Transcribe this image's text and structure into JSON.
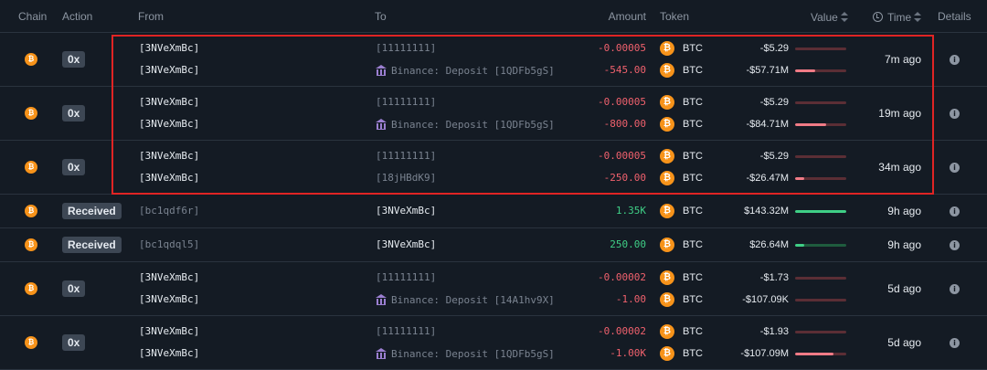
{
  "header": {
    "chain": "Chain",
    "action": "Action",
    "from": "From",
    "to": "To",
    "amount": "Amount",
    "token": "Token",
    "value": "Value",
    "time": "Time",
    "details": "Details"
  },
  "colors": {
    "highlight_border": "#e02424",
    "negative": "#f0616d",
    "positive": "#3fcf86",
    "btc": "#f7931a"
  },
  "rows": [
    {
      "action": "0x",
      "time": "7m ago",
      "lines": [
        {
          "from": "[3NVeXmBc]",
          "to": "[11111111]",
          "amount": "-0.00005",
          "token": "BTC",
          "value": "-$5.29",
          "bar": 0.0
        },
        {
          "from": "[3NVeXmBc]",
          "to": "Binance: Deposit [1QDFb5gS]",
          "amount": "-545.00",
          "token": "BTC",
          "value": "-$57.71M",
          "bar": 0.4
        }
      ]
    },
    {
      "action": "0x",
      "time": "19m ago",
      "lines": [
        {
          "from": "[3NVeXmBc]",
          "to": "[11111111]",
          "amount": "-0.00005",
          "token": "BTC",
          "value": "-$5.29",
          "bar": 0.0
        },
        {
          "from": "[3NVeXmBc]",
          "to": "Binance: Deposit [1QDFb5gS]",
          "amount": "-800.00",
          "token": "BTC",
          "value": "-$84.71M",
          "bar": 0.6
        }
      ]
    },
    {
      "action": "0x",
      "time": "34m ago",
      "lines": [
        {
          "from": "[3NVeXmBc]",
          "to": "[11111111]",
          "amount": "-0.00005",
          "token": "BTC",
          "value": "-$5.29",
          "bar": 0.0
        },
        {
          "from": "[3NVeXmBc]",
          "to": "[18jHBdK9]",
          "amount": "-250.00",
          "token": "BTC",
          "value": "-$26.47M",
          "bar": 0.18
        }
      ]
    },
    {
      "action": "Received",
      "time": "9h ago",
      "lines": [
        {
          "from": "[bc1qdf6r]",
          "to": "[3NVeXmBc]",
          "amount": "1.35K",
          "token": "BTC",
          "value": "$143.32M",
          "bar": 1.0
        }
      ]
    },
    {
      "action": "Received",
      "time": "9h ago",
      "lines": [
        {
          "from": "[bc1qdql5]",
          "to": "[3NVeXmBc]",
          "amount": "250.00",
          "token": "BTC",
          "value": "$26.64M",
          "bar": 0.18
        }
      ]
    },
    {
      "action": "0x",
      "time": "5d ago",
      "lines": [
        {
          "from": "[3NVeXmBc]",
          "to": "[11111111]",
          "amount": "-0.00002",
          "token": "BTC",
          "value": "-$1.73",
          "bar": 0.0
        },
        {
          "from": "[3NVeXmBc]",
          "to": "Binance: Deposit [14A1hv9X]",
          "amount": "-1.00",
          "token": "BTC",
          "value": "-$107.09K",
          "bar": 0.0
        }
      ]
    },
    {
      "action": "0x",
      "time": "5d ago",
      "lines": [
        {
          "from": "[3NVeXmBc]",
          "to": "[11111111]",
          "amount": "-0.00002",
          "token": "BTC",
          "value": "-$1.93",
          "bar": 0.0
        },
        {
          "from": "[3NVeXmBc]",
          "to": "Binance: Deposit [1QDFb5gS]",
          "amount": "-1.00K",
          "token": "BTC",
          "value": "-$107.09M",
          "bar": 0.75
        }
      ]
    }
  ]
}
